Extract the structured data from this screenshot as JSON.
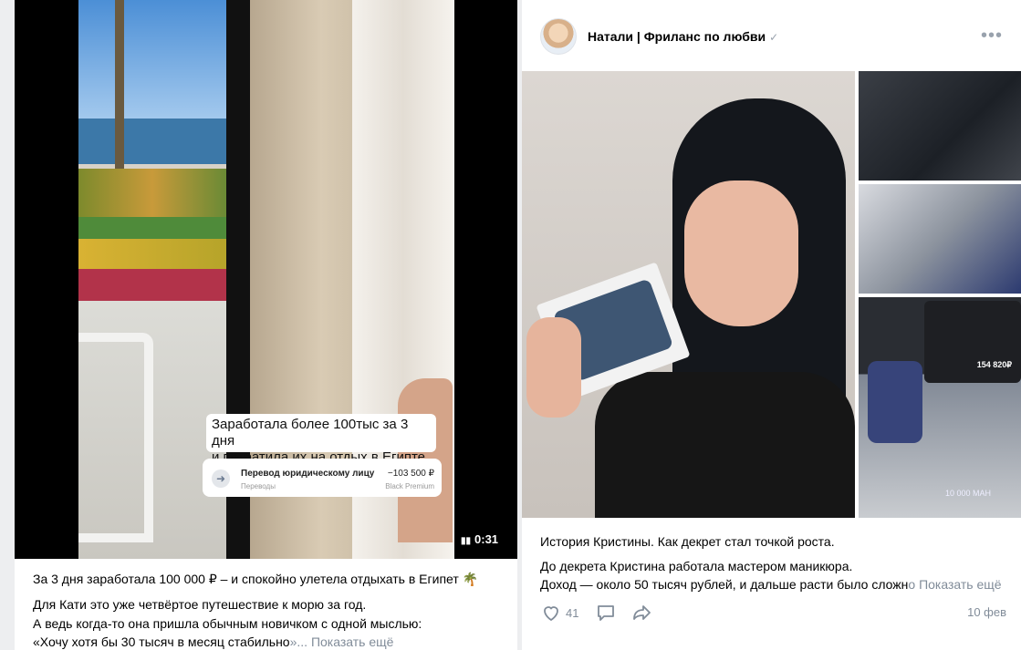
{
  "left_post": {
    "video": {
      "caption_line1": "Заработала более 100тыс за 3 дня",
      "caption_line2": "и потратила их на отдых в Египте",
      "transfer_title": "Перевод юридическому лицу",
      "transfer_subtitle": "Переводы",
      "transfer_amount": "−103 500 ₽",
      "transfer_card": "Black Premium",
      "duration": "0:31"
    },
    "text_line1": "За 3 дня заработала 100 000 ₽ – и спокойно улетела отдыхать в Египет 🌴",
    "text_line2": "Для Кати это уже четвёртое путешествие к морю за год.",
    "text_line3": "А ведь когда-то она пришла обычным новичком с одной мыслью:",
    "text_line4": "«Хочу хотя бы 30 тысяч в месяц стабильно",
    "text_line4_fade": "»...",
    "show_more": "Показать ещё"
  },
  "right_post": {
    "author": "Натали | Фриланс по любви",
    "verified_icon": "✓",
    "menu_icon": "•••",
    "text_line1": "История Кристины. Как декрет стал точкой роста.",
    "text_line2": "До декрета Кристина работала мастером маникюра.",
    "text_line3": "Доход — около 50 тысяч рублей, и дальше расти было сложн",
    "text_line3_fade": "о",
    "show_more": "Показать ещё",
    "thumb_price": "154 820₽",
    "thumb_powerbank": "10 000 MAH",
    "likes": "41",
    "date": "10 фев"
  },
  "colors": {
    "page_bg": "#edeef0",
    "card_bg": "#ffffff",
    "secondary_text": "#818c99",
    "icon_gray": "#99a2ad"
  }
}
